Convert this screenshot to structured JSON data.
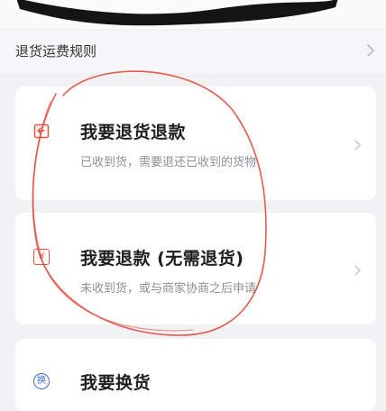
{
  "return_shipping_rule": {
    "label": "退货运费规则"
  },
  "options": [
    {
      "title": "我要退货退款",
      "subtitle": "已收到货，需要退还已收到的货物",
      "icon": "return-package-icon"
    },
    {
      "title": "我要退款 (无需退货)",
      "subtitle": "未收到货，或与商家协商之后申请",
      "icon": "yuan-receipt-icon"
    },
    {
      "title": "我要换货",
      "subtitle": "",
      "icon": "exchange-icon"
    }
  ],
  "icon_glyphs": {
    "yuan": "¥",
    "exchange": "换"
  },
  "colors": {
    "accent": "#e5553b",
    "annotation": "#e04a3c",
    "background": "#f2f2f4",
    "card": "#ffffff"
  }
}
